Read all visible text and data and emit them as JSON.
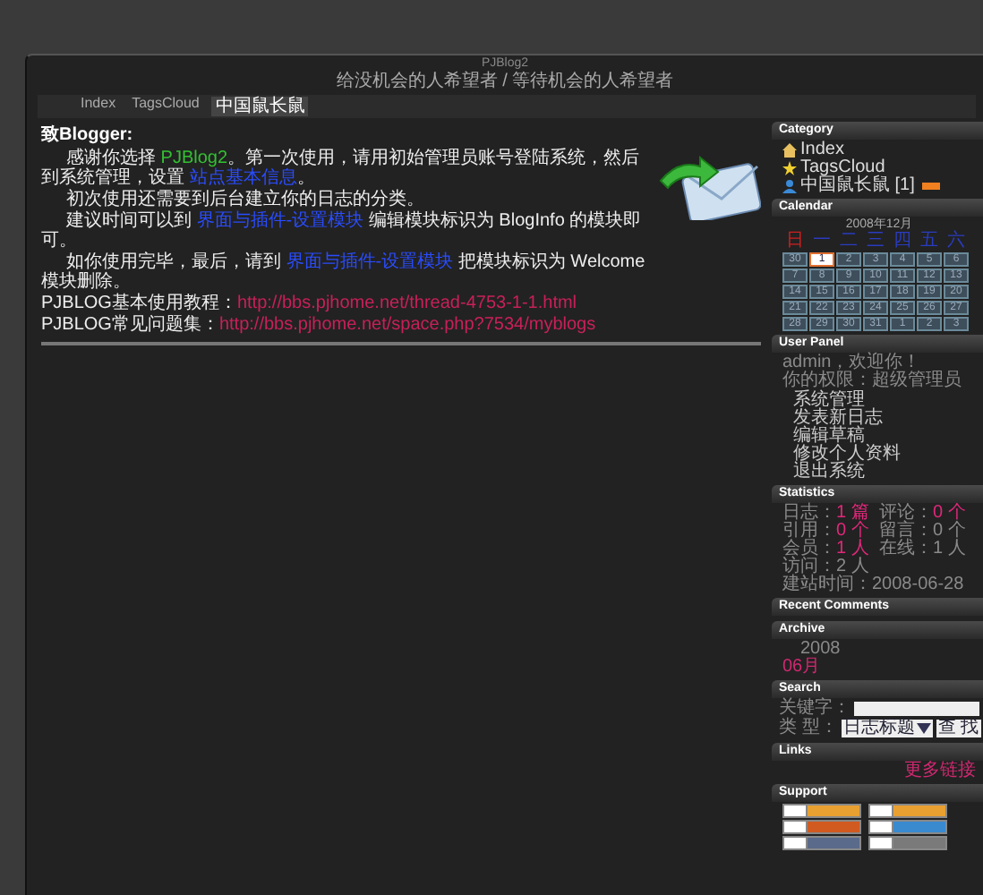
{
  "blog": {
    "title": "PJBlog2",
    "subtitle": "给没机会的人希望者 / 等待机会的人希望者"
  },
  "nav": [
    {
      "label": "Index",
      "selected": false
    },
    {
      "label": "TagsCloud",
      "selected": false
    },
    {
      "label": "中国鼠长鼠",
      "selected": true
    }
  ],
  "welcome": {
    "greeting": "致Blogger:",
    "lines": [
      [
        {
          "kind": "text",
          "text": "感谢你选择 "
        },
        {
          "kind": "brand",
          "text": "PJBlog2"
        },
        {
          "kind": "text",
          "text": "。第一次使用，请用初始管理员账号登陆系统，然后到系统管理，设置 "
        },
        {
          "kind": "link",
          "text": "站点基本信息"
        },
        {
          "kind": "text",
          "text": "。"
        }
      ],
      [
        {
          "kind": "text",
          "text": "初次使用还需要到后台建立你的日志的分类。"
        }
      ],
      [
        {
          "kind": "text",
          "text": "建议时间可以到 "
        },
        {
          "kind": "link",
          "text": "界面与插件-设置模块"
        },
        {
          "kind": "text",
          "text": " 编辑模块标识为 BlogInfo 的模块即可。"
        }
      ],
      [
        {
          "kind": "text",
          "text": "如你使用完毕，最后，请到 "
        },
        {
          "kind": "link",
          "text": "界面与插件-设置模块"
        },
        {
          "kind": "text",
          "text": " 把模块标识为 Welcome 模块删除。"
        }
      ],
      [
        {
          "kind": "text",
          "text": "PJBLOG基本使用教程："
        },
        {
          "kind": "url",
          "text": "http://bbs.pjhome.net/thread-4753-1-1.html"
        }
      ],
      [
        {
          "kind": "text",
          "text": "PJBLOG常见问题集："
        },
        {
          "kind": "url",
          "text": "http://bbs.pjhome.net/space.php?7534/myblogs"
        }
      ]
    ]
  },
  "sidebar": [
    {
      "kind": "categories",
      "title": "Category",
      "items": [
        {
          "label": "Index",
          "new": false
        },
        {
          "label": "TagsCloud",
          "new": false
        },
        {
          "label": "中国鼠长鼠 [1]",
          "new": true
        }
      ]
    },
    {
      "kind": "calendar",
      "title": "Calendar",
      "month": "2008年12月",
      "weekdays": [
        "日",
        "一",
        "二",
        "三",
        "四",
        "五",
        "六"
      ],
      "weeks": [
        [
          {
            "day": "30",
            "selected": false
          },
          {
            "day": "1",
            "selected": true
          },
          {
            "day": "2",
            "selected": false
          },
          {
            "day": "3",
            "selected": false
          },
          {
            "day": "4",
            "selected": false
          },
          {
            "day": "5",
            "selected": false
          },
          {
            "day": "6",
            "selected": false
          }
        ],
        [
          {
            "day": "7",
            "selected": false
          },
          {
            "day": "8",
            "selected": false
          },
          {
            "day": "9",
            "selected": false
          },
          {
            "day": "10",
            "selected": false
          },
          {
            "day": "11",
            "selected": false
          },
          {
            "day": "12",
            "selected": false
          },
          {
            "day": "13",
            "selected": false
          }
        ],
        [
          {
            "day": "14",
            "selected": false
          },
          {
            "day": "15",
            "selected": false
          },
          {
            "day": "16",
            "selected": false
          },
          {
            "day": "17",
            "selected": false
          },
          {
            "day": "18",
            "selected": false
          },
          {
            "day": "19",
            "selected": false
          },
          {
            "day": "20",
            "selected": false
          }
        ],
        [
          {
            "day": "21",
            "selected": false
          },
          {
            "day": "22",
            "selected": false
          },
          {
            "day": "23",
            "selected": false
          },
          {
            "day": "24",
            "selected": false
          },
          {
            "day": "25",
            "selected": false
          },
          {
            "day": "26",
            "selected": false
          },
          {
            "day": "27",
            "selected": false
          }
        ],
        [
          {
            "day": "28",
            "selected": false
          },
          {
            "day": "29",
            "selected": false
          },
          {
            "day": "30",
            "selected": false
          },
          {
            "day": "31",
            "selected": false
          },
          {
            "day": "1",
            "selected": false
          },
          {
            "day": "2",
            "selected": false
          },
          {
            "day": "3",
            "selected": false
          }
        ]
      ]
    },
    {
      "kind": "user",
      "title": "User Panel",
      "info": [
        "admin，欢迎你！",
        "你的权限：超级管理员"
      ],
      "links": [
        "系统管理",
        "发表新日志",
        "编辑草稿",
        "修改个人资料",
        "退出系统"
      ]
    },
    {
      "kind": "stats",
      "title": "Statistics",
      "items": [
        {
          "label": "日志：",
          "value": "1 篇",
          "color": "#e0287a"
        },
        {
          "label": "评论：",
          "value": "0 个",
          "color": "#e0287a"
        },
        {
          "label": "引用：",
          "value": "0 个",
          "color": "#e0287a"
        },
        {
          "label": "留言：",
          "value": "0 个",
          "color": "#8a8a8a"
        },
        {
          "label": "会员：",
          "value": "1 人",
          "color": "#e0287a"
        },
        {
          "label": "在线：",
          "value": "1 人",
          "color": "#8a8a8a"
        },
        {
          "label": "访问：",
          "value": "2 人",
          "color": "#8a8a8a"
        },
        {
          "label": "建站时间：",
          "value": "2008-06-28",
          "color": "#8a8a8a"
        }
      ]
    },
    {
      "kind": "comments",
      "title": "Recent Comments"
    },
    {
      "kind": "archive",
      "title": "Archive",
      "year": "2008",
      "month": "06月"
    },
    {
      "kind": "search",
      "title": "Search",
      "keyword_label": "关键字：",
      "type_label": "类 型：",
      "type_value": "日志标题",
      "button": "查 找"
    },
    {
      "kind": "links",
      "title": "Links",
      "more": "更多链接"
    },
    {
      "kind": "support",
      "title": "Support",
      "badges": [
        {
          "color": "#e8a030"
        },
        {
          "color": "#e8a030"
        },
        {
          "color": "#d05a20"
        },
        {
          "color": "#3a8ad0"
        },
        {
          "color": "#5a6a8a"
        },
        {
          "color": "#7a7a7a"
        }
      ]
    }
  ]
}
